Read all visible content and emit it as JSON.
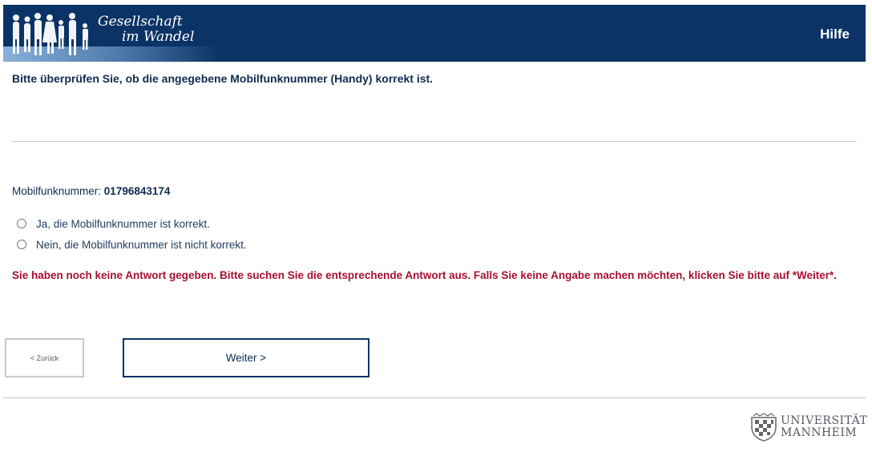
{
  "header": {
    "logo_line1": "Gesellschaft",
    "logo_line2": "im Wandel",
    "help_link": "Hilfe"
  },
  "question": "Bitte überprüfen Sie, ob die angegebene Mobilfunknummer (Handy) korrekt ist.",
  "mobile": {
    "label": "Mobilfunknummer: ",
    "number": "01796843174"
  },
  "options": [
    {
      "label": "Ja, die Mobilfunknummer ist korrekt.",
      "selected": false
    },
    {
      "label": "Nein, die Mobilfunknummer ist nicht korrekt.",
      "selected": false
    }
  ],
  "error_message": "Sie haben noch keine Antwort gegeben. Bitte suchen Sie die entsprechende Antwort aus. Falls Sie keine Angabe machen möchten, klicken Sie bitte auf *Weiter*.",
  "buttons": {
    "back": "< Zurück",
    "next": "Weiter >"
  },
  "footer": {
    "logo_line1": "UNIVERSITÄT",
    "logo_line2": "MANNHEIM",
    "logo_icon": "university-crest-icon"
  },
  "colors": {
    "header_bg": "#0c3366",
    "error": "#a8102e",
    "text": "#0f2b52"
  }
}
